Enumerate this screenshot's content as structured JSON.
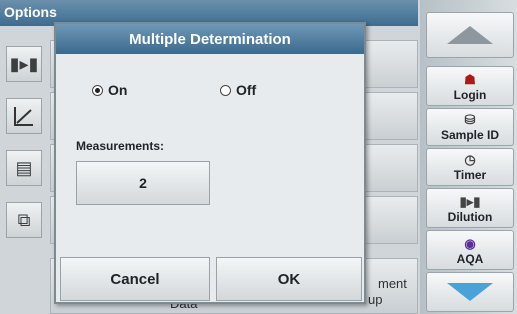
{
  "background": {
    "window_title": "Options",
    "bottom_left_text": "Data",
    "bottom_right_text": "ment",
    "bottom_right_text2": "up"
  },
  "sidebar": {
    "items": [
      {
        "label": "Login",
        "icon": "person-icon"
      },
      {
        "label": "Sample ID",
        "icon": "vial-icon"
      },
      {
        "label": "Timer",
        "icon": "timer-icon"
      },
      {
        "label": "Dilution",
        "icon": "dilution-icon"
      },
      {
        "label": "AQA",
        "icon": "aqa-icon"
      }
    ],
    "scroll_up": "arrow-up-icon",
    "scroll_down": "arrow-down-icon"
  },
  "dialog": {
    "title": "Multiple Determination",
    "options": [
      {
        "label": "On",
        "selected": true
      },
      {
        "label": "Off",
        "selected": false
      }
    ],
    "measurements_label": "Measurements:",
    "measurements_value": "2",
    "cancel_label": "Cancel",
    "ok_label": "OK"
  },
  "colors": {
    "header_blue": "#3e6c90",
    "down_arrow": "#4aa3d8"
  }
}
